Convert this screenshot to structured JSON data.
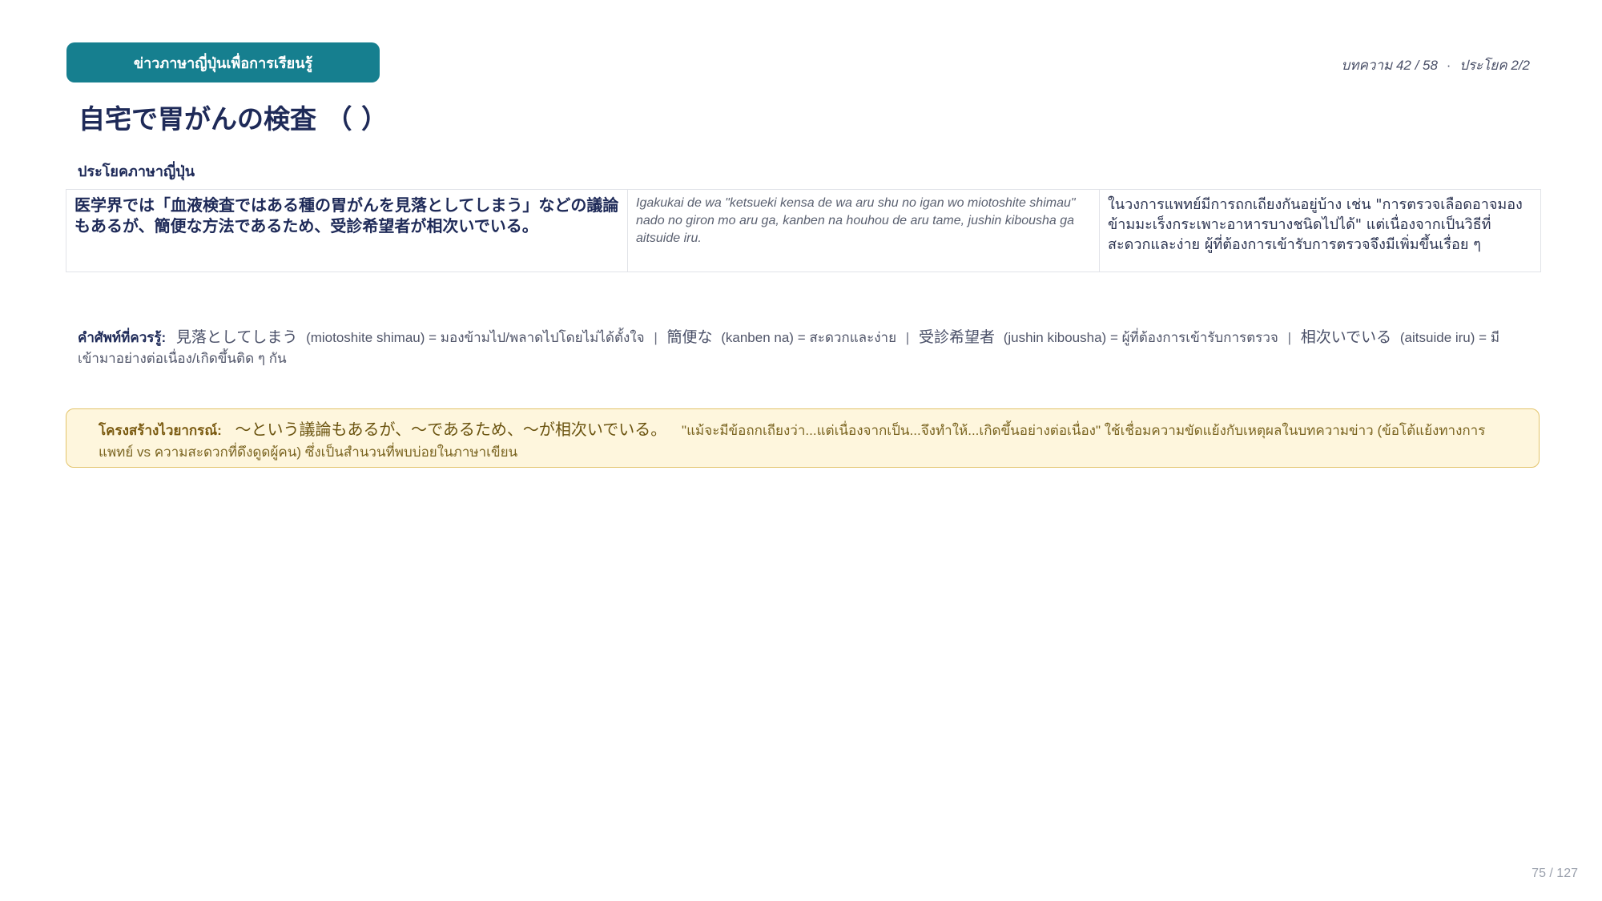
{
  "header": {
    "badge": "ข่าวภาษาญี่ปุ่นเพื่อการเรียนรู้",
    "article_label": "บทความ",
    "article_pos": "42 / 58",
    "sentence_label": "ประโยค",
    "sentence_pos": "2/2"
  },
  "title": "自宅で胃がんの検査 （ ）",
  "section": {
    "subheading": "ประโยคภาษาญี่ปุ่น"
  },
  "sentence": {
    "japanese": "医学界では「血液検査ではある種の胃がんを見落としてしまう」などの議論もあるが、簡便な方法であるため、受診希望者が相次いでいる。",
    "romaji": "Igakukai de wa \"ketsueki kensa de wa aru shu no igan wo miotoshite shimau\" nado no giron mo aru ga, kanben na houhou de aru tame, jushin kibousha ga aitsuide iru.",
    "translation": "ในวงการแพทย์มีการถกเถียงกันอยู่บ้าง เช่น \"การตรวจเลือดอาจมองข้ามมะเร็งกระเพาะอาหารบางชนิดไปได้\" แต่เนื่องจากเป็นวิธีที่สะดวกและง่าย ผู้ที่ต้องการเข้ารับการตรวจจึงมีเพิ่มขึ้นเรื่อย ๆ"
  },
  "vocab": {
    "label": "คำศัพท์ที่ควรรู้:",
    "items": [
      {
        "word": "見落としてしまう",
        "reading": "(miotoshite shimau)",
        "meaning": "= มองข้ามไป/พลาดไปโดยไม่ได้ตั้งใจ"
      },
      {
        "word": "簡便な",
        "reading": "(kanben na)",
        "meaning": "= สะดวกและง่าย"
      },
      {
        "word": "受診希望者",
        "reading": "(jushin kibousha)",
        "meaning": "= ผู้ที่ต้องการเข้ารับการตรวจ"
      },
      {
        "word": "相次いでいる",
        "reading": "(aitsuide iru)",
        "meaning": "= มีเข้ามาอย่างต่อเนื่อง/เกิดขึ้นติด ๆ กัน"
      }
    ],
    "separator": "|"
  },
  "grammar_note": {
    "label": "โครงสร้างไวยากรณ์:",
    "pattern": "～という議論もあるが、～であるため、～が相次いでいる。",
    "text": "\"แม้จะมีข้อถกเถียงว่า...แต่เนื่องจากเป็น...จึงทำให้...เกิดขึ้นอย่างต่อเนื่อง\" ใช้เชื่อมความขัดแย้งกับเหตุผลในบทความข่าว (ข้อโต้แย้งทางการแพทย์ vs ความสะดวกที่ดึงดูดผู้คน) ซึ่งเป็นสำนวนที่พบบ่อยในภาษาเขียน"
  },
  "footer": {
    "page": "75 / 127"
  }
}
